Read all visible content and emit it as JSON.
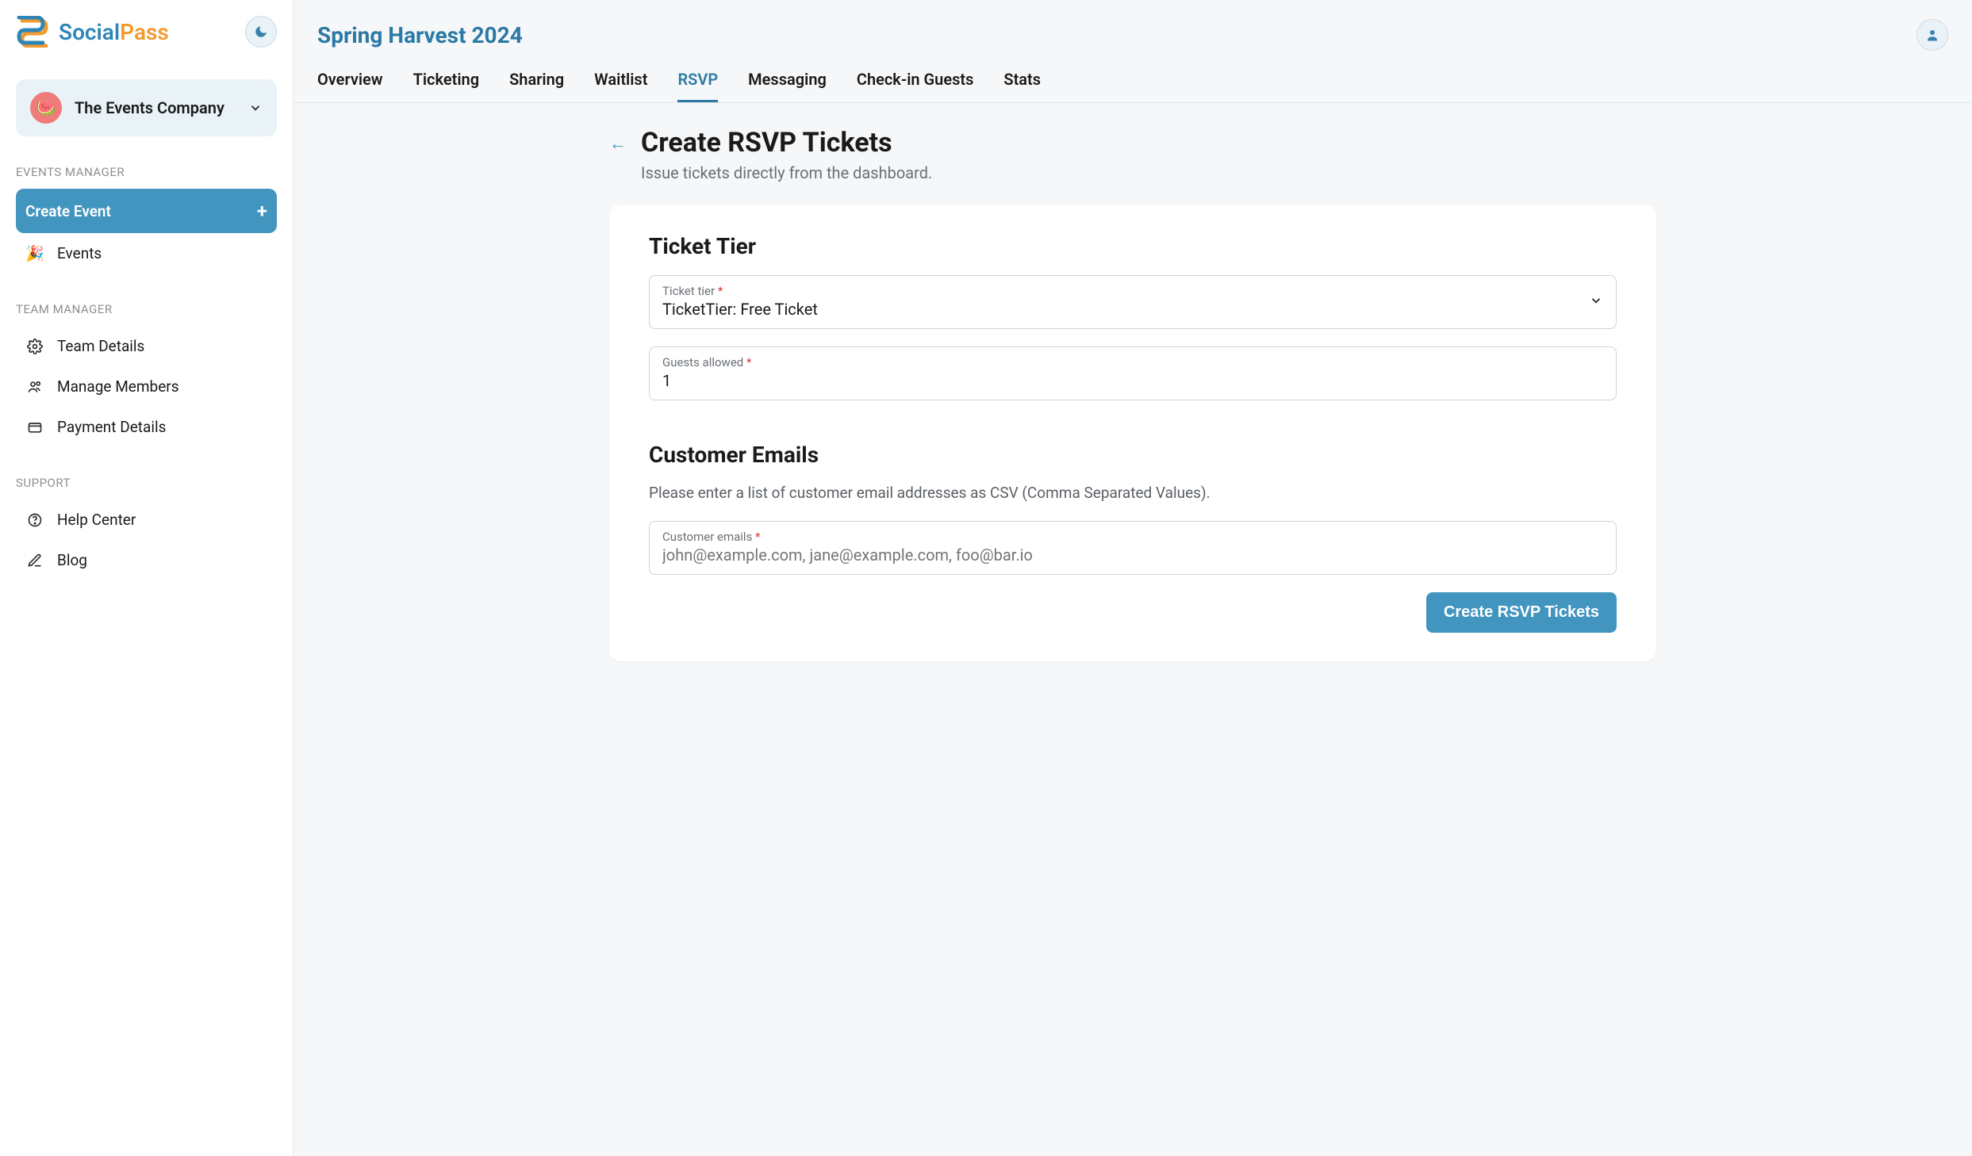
{
  "brand": {
    "name_part1": "Social",
    "name_part2": "Pass"
  },
  "org": {
    "name": "The Events Company"
  },
  "sidebar": {
    "sections": {
      "events_manager": {
        "label": "EVENTS MANAGER"
      },
      "team_manager": {
        "label": "TEAM MANAGER"
      },
      "support": {
        "label": "SUPPORT"
      }
    },
    "create_event": "Create Event",
    "events": "Events",
    "team_details": "Team Details",
    "manage_members": "Manage Members",
    "payment_details": "Payment Details",
    "help_center": "Help Center",
    "blog": "Blog"
  },
  "event": {
    "title": "Spring Harvest 2024"
  },
  "tabs": {
    "overview": "Overview",
    "ticketing": "Ticketing",
    "sharing": "Sharing",
    "waitlist": "Waitlist",
    "rsvp": "RSVP",
    "messaging": "Messaging",
    "checkin": "Check-in Guests",
    "stats": "Stats"
  },
  "page": {
    "title": "Create RSVP Tickets",
    "subtitle": "Issue tickets directly from the dashboard."
  },
  "form": {
    "ticket_tier_section": "Ticket Tier",
    "ticket_tier": {
      "label": "Ticket tier ",
      "value": "TicketTier: Free Ticket"
    },
    "guests_allowed": {
      "label": "Guests allowed ",
      "value": "1"
    },
    "customer_emails_section": "Customer Emails",
    "customer_emails_help": "Please enter a list of customer email addresses as CSV (Comma Separated Values).",
    "customer_emails": {
      "label": "Customer emails ",
      "placeholder": "john@example.com, jane@example.com, foo@bar.io"
    },
    "submit": "Create RSVP Tickets"
  }
}
